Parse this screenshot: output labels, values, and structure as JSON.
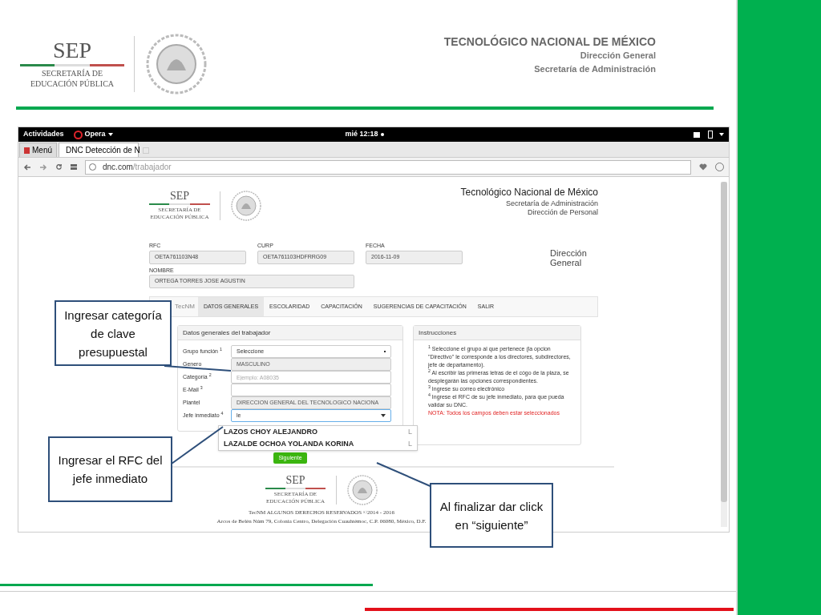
{
  "slide": {
    "logo": {
      "acronym": "SEP",
      "line1": "SECRETARÍA DE",
      "line2": "EDUCACIÓN PÚBLICA"
    },
    "org": "TECNOLÓGICO NACIONAL DE MÉXICO",
    "line2": "Dirección General",
    "line3": "Secretaría de Administración"
  },
  "browser": {
    "top_bar": {
      "activities": "Actividades",
      "app": "Opera",
      "clock": "mié 12:18"
    },
    "tabs": [
      {
        "label": "Menú",
        "selected": false
      },
      {
        "label": "DNC Detección de N",
        "selected": true
      }
    ],
    "address": {
      "domain": "dnc.com",
      "path": "/trabajador"
    }
  },
  "page": {
    "logo": {
      "acronym": "SEP",
      "line1": "SECRETARÍA DE",
      "line2": "EDUCACIÓN PÚBLICA"
    },
    "title": "Tecnológico Nacional de México",
    "sub1": "Secretaría de Administración",
    "sub2": "Dirección de Personal",
    "fields": [
      {
        "label": "RFC",
        "value": "OETA761103N48"
      },
      {
        "label": "CURP",
        "value": "OETA761103HDFRRG09"
      },
      {
        "label": "FECHA",
        "value": "2016-11-09"
      }
    ],
    "name_field": {
      "label": "NOMBRE",
      "value": "ORTEGA TORRES JOSE AGUSTIN"
    },
    "side_title": "Dirección General",
    "nav": {
      "brand": "TecNM",
      "items": [
        {
          "label": "DATOS GENERALES",
          "selected": true
        },
        {
          "label": "ESCOLARIDAD",
          "selected": false
        },
        {
          "label": "CAPACITACIÓN",
          "selected": false
        },
        {
          "label": "SUGERENCIAS DE CAPACITACIÓN",
          "selected": false
        },
        {
          "label": "SALIR",
          "selected": false
        }
      ]
    },
    "form": {
      "title": "Datos generales del trabajador",
      "rows": [
        {
          "label": "Grupo función $^{1}$",
          "kind": "select",
          "value": "Seleccione"
        },
        {
          "label": "Genero",
          "kind": "readonly",
          "value": "MASCULINO"
        },
        {
          "label": "Categoría $^{2}$",
          "kind": "input",
          "placeholder": "Ejemplo: A08035"
        },
        {
          "label": "E-Mail $^{3}$",
          "kind": "input"
        },
        {
          "label": "Plantel",
          "kind": "readonly",
          "value": "DIRECCION GENERAL DEL TECNOLOGICO NACIONA"
        },
        {
          "label": "Jefe inmediato $^{4}$",
          "kind": "combo",
          "value": "le"
        }
      ],
      "suggestions": [
        {
          "name": "LAZOS CHOY ALEJANDRO",
          "column_2": "L"
        },
        {
          "name": "LAZALDE OCHOA YOLANDA KORINA",
          "column_2": "L"
        }
      ],
      "button": "Siguiente"
    },
    "instructions": {
      "title": "Instrucciones",
      "items": [
        "$^{1}$ Seleccione el grupo al que pertenece (la opcion \"Directivo\" le corresponde a los directores, subdirectores, jefe de departamento).",
        "$^{2}$ Al escribir las primeras letras de el cógo de la plaza, se desplegarán las opciones correspondientes.",
        "$^{3}$ Ingrese su correo electrónico",
        "$^{4}$ Ingrese el RFC de su jefe inmediato, para que pueda validar su DNC."
      ],
      "note": "NOTA: Todos los campos deben estar seleccionados"
    },
    "footer": {
      "logo": {
        "acronym": "SEP",
        "line1": "SECRETARÍA DE",
        "line2": "EDUCACIÓN PÚBLICA"
      },
      "rights": "TecNM ALGUNOS DERECHOS RESERVADOS ©2014 - 2016",
      "address": "Arcos de Belén Núm 79, Colonia Centro, Delegación Cuauhtémoc, C.P. 06080, México, D.F."
    }
  },
  "callouts": [
    "Ingresar categoría de clave presupuestal",
    "Ingresar el RFC del jefe inmediato",
    "Al finalizar dar click en “siguiente”"
  ]
}
